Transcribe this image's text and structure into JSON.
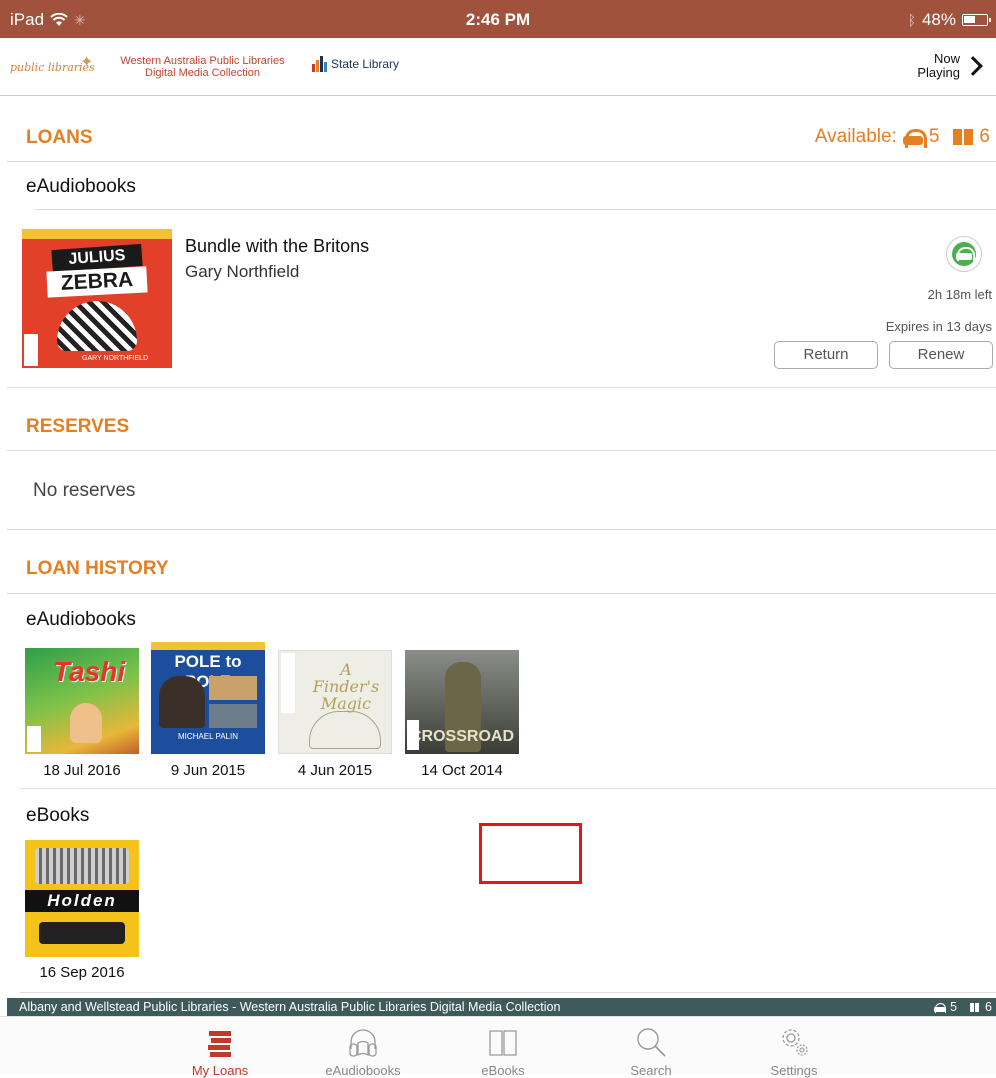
{
  "status_bar": {
    "device": "iPad",
    "time": "2:46 PM",
    "battery": "48%"
  },
  "header": {
    "logo_text": "public libraries",
    "title": "Western Australia Public Libraries Digital Media Collection",
    "state_library": "State Library",
    "now_playing": "Now Playing"
  },
  "loans": {
    "title": "LOANS",
    "available_label": "Available:",
    "available_audio": "5",
    "available_ebook": "6",
    "eaudiobooks_label": "eAudiobooks",
    "item": {
      "cover_title_1": "JULIUS",
      "cover_title_2": "ZEBRA",
      "cover_author": "GARY NORTHFIELD",
      "title": "Bundle with the Britons",
      "author": "Gary Northfield",
      "time_left": "2h 18m left",
      "expires": "Expires in 13 days",
      "return_label": "Return",
      "renew_label": "Renew"
    }
  },
  "reserves": {
    "title": "RESERVES",
    "empty": "No reserves"
  },
  "history": {
    "title": "LOAN HISTORY",
    "eaudiobooks_label": "eAudiobooks",
    "audio_items": [
      {
        "cover_text": "Tashi",
        "date": "18 Jul 2016"
      },
      {
        "cover_text": "POLE to POLE",
        "cover_author": "MICHAEL PALIN",
        "date": "9 Jun 2015"
      },
      {
        "cover_text": "A Finder's Magic",
        "date": "4 Jun 2015"
      },
      {
        "cover_text": "CROSSROAD",
        "date": "14 Oct 2014"
      }
    ],
    "ebooks_label": "eBooks",
    "ebook_items": [
      {
        "cover_text": "Holden",
        "date": "16 Sep 2016"
      }
    ]
  },
  "info_bar": {
    "text": "Albany and Wellstead Public Libraries - Western Australia Public Libraries Digital Media Collection",
    "audio_count": "5",
    "ebook_count": "6"
  },
  "tabs": [
    {
      "label": "My Loans",
      "icon": "stack-icon",
      "active": true
    },
    {
      "label": "eAudiobooks",
      "icon": "headphones-icon",
      "active": false
    },
    {
      "label": "eBooks",
      "icon": "book-icon",
      "active": false
    },
    {
      "label": "Search",
      "icon": "search-icon",
      "active": false
    },
    {
      "label": "Settings",
      "icon": "gear-icon",
      "active": false
    }
  ],
  "colors": {
    "status_bar": "#a0523c",
    "accent": "#e67e22",
    "info_bar": "#3f5a5a",
    "active_tab": "#c0392b",
    "highlight": "#e8141b"
  }
}
